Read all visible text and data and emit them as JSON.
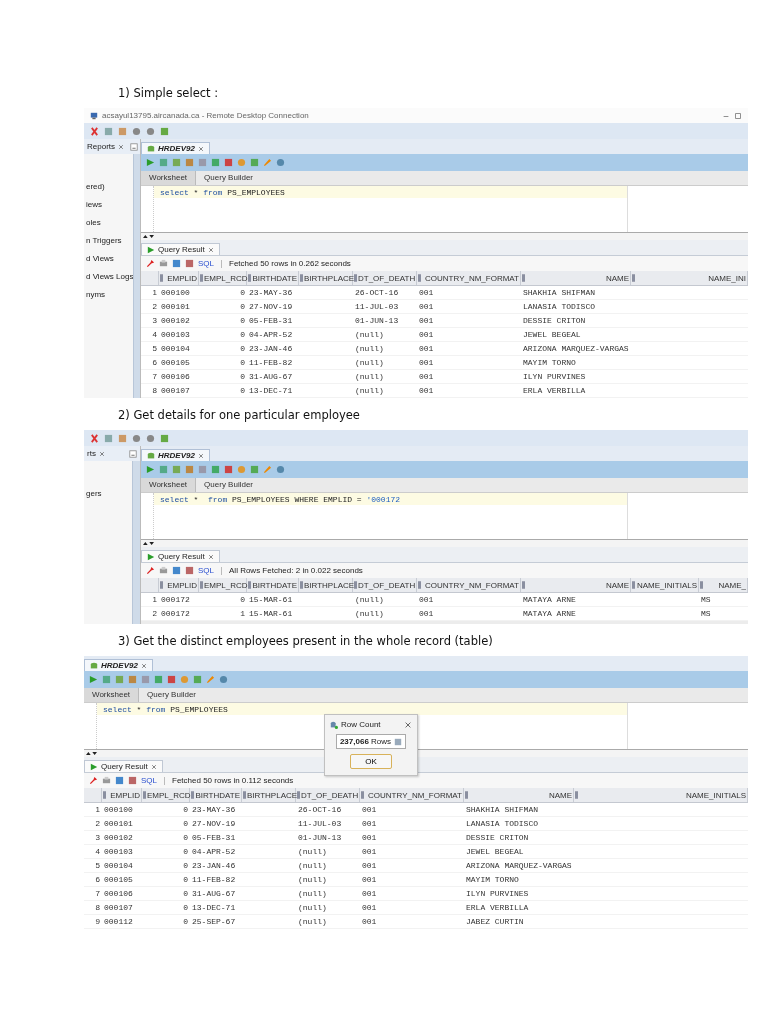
{
  "sections": [
    {
      "heading": "1) Simple select :",
      "shot": {
        "window_title": "acsayul13795.aircanada.ca - Remote Desktop Connection",
        "main_toolbar": true,
        "side_panel": {
          "tab": "Reports",
          "items": [
            "ered)",
            "iews",
            "oles",
            "n Triggers",
            "d Views",
            "d Views Logs",
            "nyms"
          ]
        },
        "editor_tab": "HRDEV92",
        "worksheet_tabs": [
          {
            "label": "Worksheet",
            "selected": true
          },
          {
            "label": "Query Builder",
            "selected": false
          }
        ],
        "query": [
          {
            "text": "select",
            "kind": "keyword"
          },
          {
            "text": " * ",
            "kind": "plain"
          },
          {
            "text": "from",
            "kind": "keyword"
          },
          {
            "text": " PS_EMPLOYEES",
            "kind": "plain"
          }
        ],
        "result_tab": "Query Result",
        "sql_link": "SQL",
        "status": "Fetched 50 rows in 0.262 seconds",
        "columns": [
          "EMPLID",
          "EMPL_RCD",
          "BIRTHDATE",
          "BIRTHPLACE",
          "DT_OF_DEATH",
          "COUNTRY_NM_FORMAT",
          "NAME",
          "NAME_INI"
        ],
        "rows": [
          {
            "num": "1",
            "cells": [
              "000100",
              "0",
              "23-MAY-36",
              null,
              "26-OCT-16",
              "001",
              "SHAKHIA SHIFMAN",
              null
            ]
          },
          {
            "num": "2",
            "cells": [
              "000101",
              "0",
              "27-NOV-19",
              null,
              "11-JUL-03",
              "001",
              "LANASIA TODISCO",
              null
            ]
          },
          {
            "num": "3",
            "cells": [
              "000102",
              "0",
              "05-FEB-31",
              null,
              "01-JUN-13",
              "001",
              "DESSIE CRITON",
              null
            ]
          },
          {
            "num": "4",
            "cells": [
              "000103",
              "0",
              "04-APR-52",
              null,
              "(null)",
              "001",
              "JEWEL BEGEAL",
              null
            ]
          },
          {
            "num": "5",
            "cells": [
              "000104",
              "0",
              "23-JAN-46",
              null,
              "(null)",
              "001",
              "ARIZONA MARQUEZ-VARGAS",
              null
            ]
          },
          {
            "num": "6",
            "cells": [
              "000105",
              "0",
              "11-FEB-82",
              null,
              "(null)",
              "001",
              "MAYIM TORNO",
              null
            ]
          },
          {
            "num": "7",
            "cells": [
              "000106",
              "0",
              "31-AUG-67",
              null,
              "(null)",
              "001",
              "ILYN PURVINES",
              null
            ]
          },
          {
            "num": "8",
            "cells": [
              "000107",
              "0",
              "13-DEC-71",
              null,
              "(null)",
              "001",
              "ERLA VERBILLA",
              null
            ]
          }
        ]
      }
    },
    {
      "heading": "2) Get details for one particular employee",
      "shot": {
        "main_toolbar": true,
        "side_panel": {
          "tab": "rts",
          "items": [
            "gers"
          ]
        },
        "editor_tab": "HRDEV92",
        "worksheet_tabs": [
          {
            "label": "Worksheet",
            "selected": true
          },
          {
            "label": "Query Builder",
            "selected": false
          }
        ],
        "query": [
          {
            "text": "select",
            "kind": "keyword"
          },
          {
            "text": " *  ",
            "kind": "plain"
          },
          {
            "text": "from",
            "kind": "keyword"
          },
          {
            "text": " PS_EMPLOYEES WHERE EMPLID = ",
            "kind": "plain"
          },
          {
            "text": "'000172",
            "kind": "string"
          }
        ],
        "result_tab": "Query Result",
        "sql_link": "SQL",
        "status": "All Rows Fetched: 2 in 0.022 seconds",
        "columns": [
          "EMPLID",
          "EMPL_RCD",
          "BIRTHDATE",
          "BIRTHPLACE",
          "DT_OF_DEATH",
          "COUNTRY_NM_FORMAT",
          "NAME",
          "NAME_INITIALS",
          "NAME_"
        ],
        "rows": [
          {
            "num": "1",
            "cells": [
              "000172",
              "0",
              "15-MAR-61",
              null,
              "(null)",
              "001",
              "MATAYA ARNE",
              null,
              "MS"
            ]
          },
          {
            "num": "2",
            "cells": [
              "000172",
              "1",
              "15-MAR-61",
              null,
              "(null)",
              "001",
              "MATAYA ARNE",
              null,
              "MS"
            ]
          }
        ]
      }
    },
    {
      "heading": "3) Get the distinct employees present in the whole record (table)",
      "shot": {
        "main_toolbar": false,
        "editor_tab": "HRDEV92",
        "worksheet_tabs": [
          {
            "label": "Worksheet",
            "selected": true
          },
          {
            "label": "Query Builder",
            "selected": false
          }
        ],
        "query": [
          {
            "text": "select",
            "kind": "keyword"
          },
          {
            "text": " * ",
            "kind": "plain"
          },
          {
            "text": "from",
            "kind": "keyword"
          },
          {
            "text": " PS_EMPLOYEES",
            "kind": "plain"
          }
        ],
        "dialog": {
          "title": "Row Count",
          "value": "**237,066** Rows",
          "button": "OK"
        },
        "result_tab": "Query Result",
        "sql_link": "SQL",
        "status": "Fetched 50 rows in 0.112 seconds",
        "columns": [
          "EMPLID",
          "EMPL_RCD",
          "BIRTHDATE",
          "BIRTHPLACE",
          "DT_OF_DEATH",
          "COUNTRY_NM_FORMAT",
          "NAME",
          "NAME_INITIALS"
        ],
        "rows": [
          {
            "num": "1",
            "cells": [
              "000100",
              "0",
              "23-MAY-36",
              null,
              "26-OCT-16",
              "001",
              "SHAKHIA SHIFMAN",
              null
            ]
          },
          {
            "num": "2",
            "cells": [
              "000101",
              "0",
              "27-NOV-19",
              null,
              "11-JUL-03",
              "001",
              "LANASIA TODISCO",
              null
            ]
          },
          {
            "num": "3",
            "cells": [
              "000102",
              "0",
              "05-FEB-31",
              null,
              "01-JUN-13",
              "001",
              "DESSIE CRITON",
              null
            ]
          },
          {
            "num": "4",
            "cells": [
              "000103",
              "0",
              "04-APR-52",
              null,
              "(null)",
              "001",
              "JEWEL BEGEAL",
              null
            ]
          },
          {
            "num": "5",
            "cells": [
              "000104",
              "0",
              "23-JAN-46",
              null,
              "(null)",
              "001",
              "ARIZONA MARQUEZ-VARGAS",
              null
            ]
          },
          {
            "num": "6",
            "cells": [
              "000105",
              "0",
              "11-FEB-82",
              null,
              "(null)",
              "001",
              "MAYIM TORNO",
              null
            ]
          },
          {
            "num": "7",
            "cells": [
              "000106",
              "0",
              "31-AUG-67",
              null,
              "(null)",
              "001",
              "ILYN PURVINES",
              null
            ]
          },
          {
            "num": "8",
            "cells": [
              "000107",
              "0",
              "13-DEC-71",
              null,
              "(null)",
              "001",
              "ERLA VERBILLA",
              null
            ]
          },
          {
            "num": "9",
            "cells": [
              "000112",
              "0",
              "25-SEP-67",
              null,
              "(null)",
              "001",
              "JABEZ CURTIN",
              null
            ]
          }
        ]
      }
    }
  ]
}
